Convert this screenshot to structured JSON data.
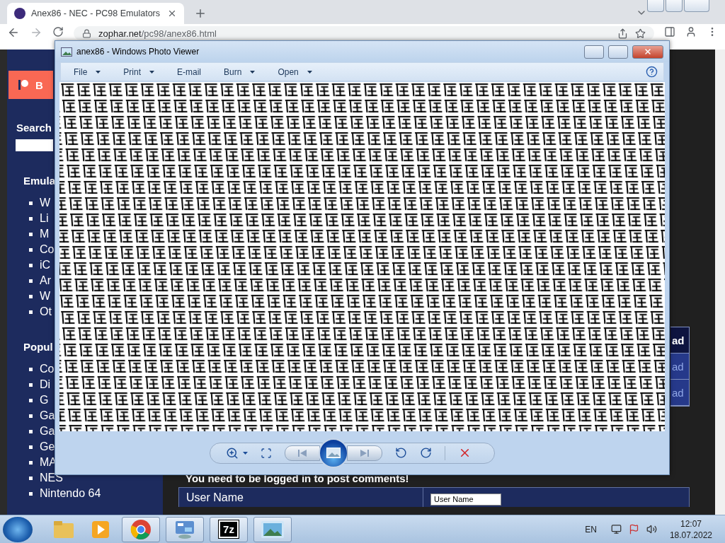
{
  "browser": {
    "tab": {
      "title": "Anex86 - NEC - PC98 Emulators",
      "selected": true
    },
    "address_host": "zophar.net",
    "address_path": "/pc98/anex86.html"
  },
  "sidebar": {
    "button": "B",
    "search_heading": "Search",
    "sections": [
      {
        "heading": "Emula",
        "items": [
          "W",
          "Li",
          "M",
          "Co",
          "iC",
          "Ar",
          "W",
          "Ot"
        ]
      },
      {
        "heading": "Popul",
        "items": [
          "Co",
          "Di",
          "G",
          "Ga",
          "Ga",
          "Ge",
          "MA",
          "NES",
          "Nintendo 64"
        ]
      }
    ]
  },
  "main": {
    "ad_buttons": [
      {
        "label": "ad",
        "selected": true
      },
      {
        "label": "ad",
        "selected": false
      },
      {
        "label": "ad",
        "selected": false
      }
    ],
    "comment_notice": "You need to be logged in to post comments!",
    "login": {
      "label": "User Name",
      "value": "User Name"
    }
  },
  "viewer": {
    "title": "anex86 - Windows Photo Viewer",
    "menu": [
      {
        "label": "File",
        "dropdown": true
      },
      {
        "label": "Print",
        "dropdown": true
      },
      {
        "label": "E-mail",
        "dropdown": false
      },
      {
        "label": "Burn",
        "dropdown": true
      },
      {
        "label": "Open",
        "dropdown": true
      }
    ]
  },
  "taskbar": {
    "apps": [
      {
        "kind": "explorer",
        "running": false
      },
      {
        "kind": "media",
        "running": false
      },
      {
        "kind": "chrome",
        "running": true
      },
      {
        "kind": "panel",
        "running": true
      },
      {
        "kind": "archiver",
        "label": "7z",
        "running": true
      },
      {
        "kind": "photos",
        "running": true
      }
    ],
    "language": "EN",
    "time": "12:07",
    "date": "18.07.2022"
  }
}
